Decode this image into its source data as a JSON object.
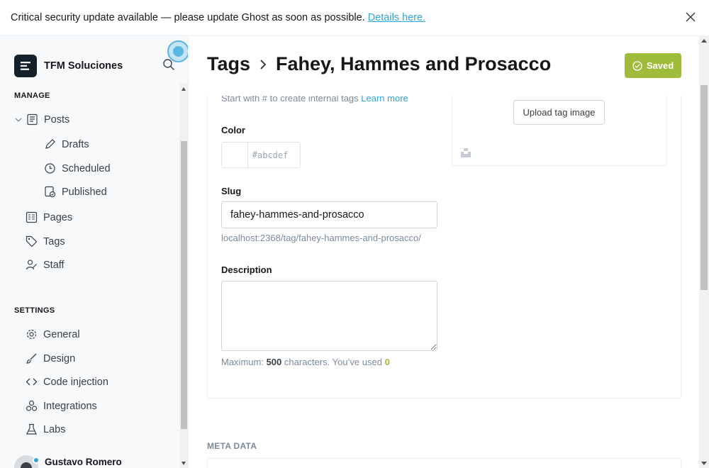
{
  "banner": {
    "message": "Critical security update available — please update Ghost as soon as possible.",
    "link": "Details here."
  },
  "sidebar": {
    "site_name": "TFM Soluciones",
    "manage_title": "MANAGE",
    "settings_title": "SETTINGS",
    "manage_items": [
      {
        "label": "Posts",
        "icon": "posts-icon"
      },
      {
        "label": "Drafts",
        "icon": "pencil-icon"
      },
      {
        "label": "Scheduled",
        "icon": "clock-icon"
      },
      {
        "label": "Published",
        "icon": "published-icon"
      },
      {
        "label": "Pages",
        "icon": "pages-icon"
      },
      {
        "label": "Tags",
        "icon": "tag-icon"
      },
      {
        "label": "Staff",
        "icon": "staff-icon"
      }
    ],
    "settings_items": [
      {
        "label": "General",
        "icon": "gear-icon"
      },
      {
        "label": "Design",
        "icon": "brush-icon"
      },
      {
        "label": "Code injection",
        "icon": "code-icon"
      },
      {
        "label": "Integrations",
        "icon": "integrations-icon"
      },
      {
        "label": "Labs",
        "icon": "flask-icon"
      }
    ],
    "user_name": "Gustavo Romero"
  },
  "header": {
    "breadcrumb_parent": "Tags",
    "title": "Fahey, Hammes and Prosacco",
    "saved_label": "Saved"
  },
  "form": {
    "hint_text": "Start with # to create internal tags",
    "hint_link": "Learn more",
    "color_label": "Color",
    "color_hash": "#",
    "color_placeholder": "abcdef",
    "slug_label": "Slug",
    "slug_value": "fahey-hammes-and-prosacco",
    "slug_url": "localhost:2368/tag/fahey-hammes-and-prosacco/",
    "description_label": "Description",
    "description_value": "",
    "max_prefix": "Maximum:",
    "max_value": "500",
    "max_middle": "characters. You’ve used",
    "used_value": "0",
    "upload_label": "Upload tag image"
  },
  "meta_title": "META DATA",
  "colors": {
    "accent": "#30a4d8",
    "saved": "#9fbb3a",
    "sidebar_bg": "#f7f9fa"
  }
}
